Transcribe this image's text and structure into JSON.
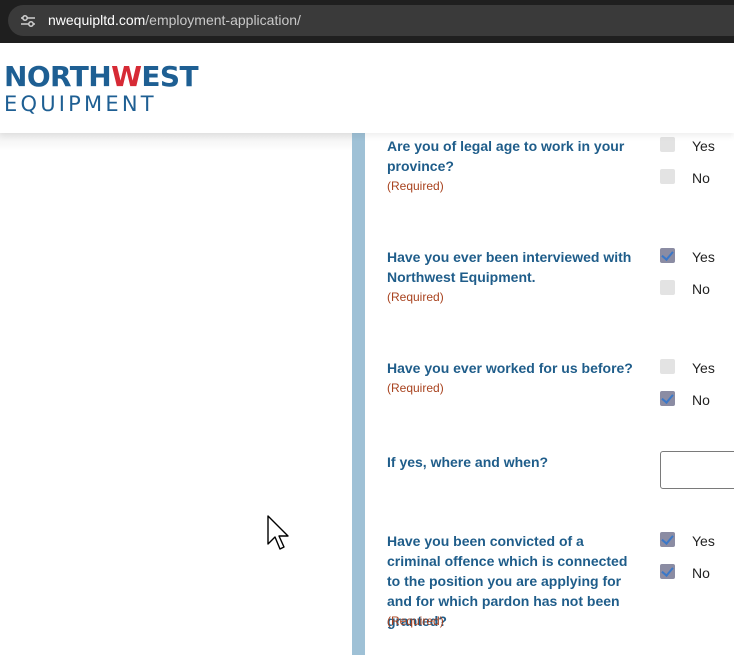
{
  "browser": {
    "url_domain": "nwequipltd.com",
    "url_path": "/employment-application/"
  },
  "header": {
    "logo_line1_a": "NORTH",
    "logo_line1_accent": "W",
    "logo_line1_b": "EST",
    "logo_line2": "EQUIPMENT"
  },
  "form": {
    "questions": [
      {
        "text": "Are you of legal age to work in your province?",
        "required": "(Required)",
        "options": [
          {
            "label": "Yes",
            "checked": false
          },
          {
            "label": "No",
            "checked": false
          }
        ]
      },
      {
        "text": "Have you ever been interviewed with Northwest Equipment.",
        "required": "(Required)",
        "options": [
          {
            "label": "Yes",
            "checked": true
          },
          {
            "label": "No",
            "checked": false
          }
        ]
      },
      {
        "text": "Have you ever worked for us before?",
        "required": "(Required)",
        "options": [
          {
            "label": "Yes",
            "checked": false
          },
          {
            "label": "No",
            "checked": true
          }
        ]
      },
      {
        "text": "If yes, where and when?",
        "input_value": ""
      },
      {
        "text": "Have you been convicted of a criminal offence which is connected to the position you are applying for and for which pardon has not been granted?",
        "required": "(Required)",
        "options": [
          {
            "label": "Yes",
            "checked": true
          },
          {
            "label": "No",
            "checked": true
          }
        ]
      }
    ]
  },
  "colors": {
    "brand_blue": "#1e5f93",
    "brand_red": "#d62a35",
    "question_text": "#1f5d8a",
    "required_text": "#a8431f",
    "divider": "#9fc1d6"
  }
}
